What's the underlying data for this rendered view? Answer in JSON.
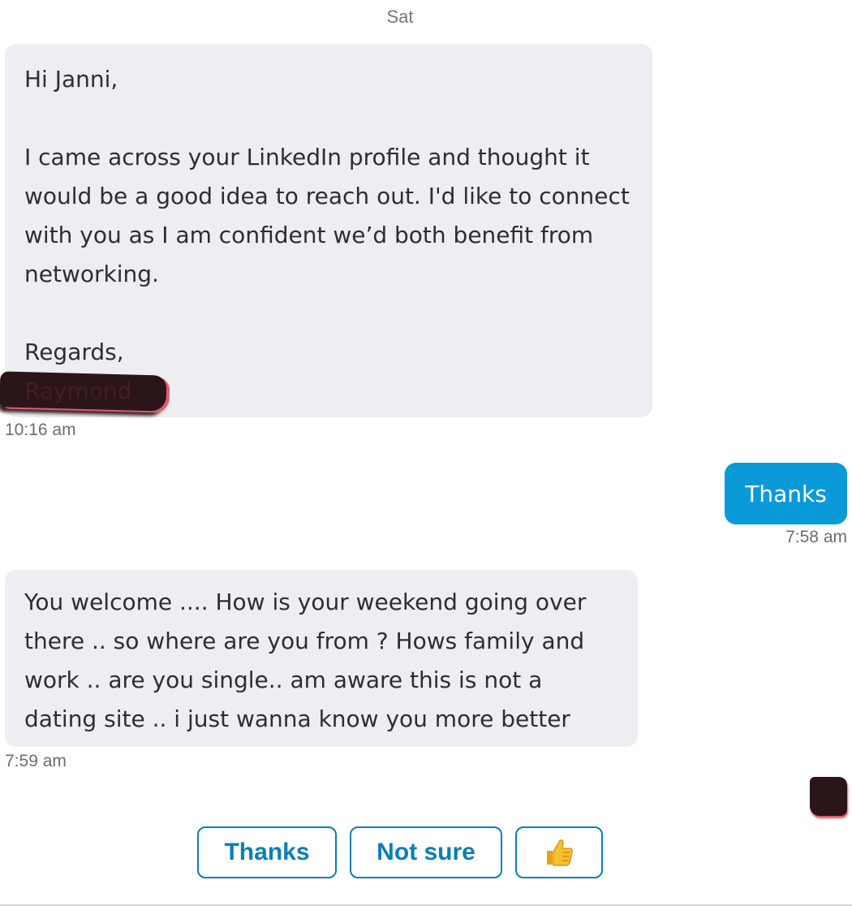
{
  "conversation": {
    "day_label": "Sat",
    "messages": [
      {
        "direction": "incoming",
        "greeting": "Hi Janni,",
        "body": "I came across your LinkedIn profile and thought it would be a good idea to reach out. I'd like to connect with you as I am confident we’d both benefit from networking.",
        "closing": "Regards,",
        "signature": "Raymond",
        "time": "10:16 am"
      },
      {
        "direction": "outgoing",
        "text": "Thanks",
        "time": "7:58 am"
      },
      {
        "direction": "incoming",
        "text": "You welcome .... How is your weekend going over there .. so where are you from ? Hows family and work .. are you single.. am aware this is not a dating site .. i just wanna know you more better",
        "time": "7:59 am"
      }
    ]
  },
  "quick_replies": {
    "thanks": "Thanks",
    "not_sure": "Not sure",
    "like_icon": "thumbs-up-icon"
  },
  "colors": {
    "incoming_bubble": "#eceef1",
    "outgoing_bubble": "#0a9ad9",
    "quick_reply_accent": "#0a7fb6",
    "redaction": "#2a1618"
  }
}
